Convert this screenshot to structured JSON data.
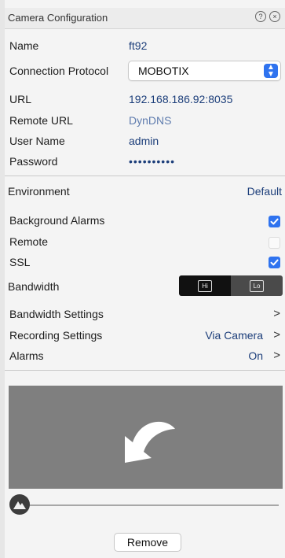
{
  "window": {
    "title": "Camera Configuration",
    "help_icon": "question-circle-icon",
    "close_icon": "close-circle-icon"
  },
  "fields": {
    "name": {
      "label": "Name",
      "value": "ft92"
    },
    "protocol": {
      "label": "Connection Protocol",
      "value": "MOBOTIX"
    },
    "url": {
      "label": "URL",
      "value": "192.168.186.92:8035"
    },
    "remote_url": {
      "label": "Remote URL",
      "value": "DynDNS"
    },
    "user_name": {
      "label": "User Name",
      "value": "admin"
    },
    "password": {
      "label": "Password",
      "value": "••••••••••"
    }
  },
  "environment": {
    "label": "Environment",
    "value": "Default"
  },
  "toggles": {
    "background_alarms": {
      "label": "Background Alarms",
      "checked": true
    },
    "remote": {
      "label": "Remote",
      "checked": false
    },
    "ssl": {
      "label": "SSL",
      "checked": true
    }
  },
  "bandwidth": {
    "label": "Bandwidth",
    "options": [
      "Hi",
      "Lo"
    ],
    "selected": "Hi"
  },
  "nav": {
    "bandwidth_settings": {
      "label": "Bandwidth Settings",
      "value": ""
    },
    "recording_settings": {
      "label": "Recording Settings",
      "value": "Via Camera"
    },
    "alarms": {
      "label": "Alarms",
      "value": "On"
    }
  },
  "preview": {
    "icon": "rotate-back-arrow-icon"
  },
  "slider_icon": "mountain-icon",
  "remove_label": "Remove",
  "colors": {
    "accent": "#2f73ef",
    "value_text": "#1c3e7a",
    "preview_bg": "#7f7f7f"
  }
}
